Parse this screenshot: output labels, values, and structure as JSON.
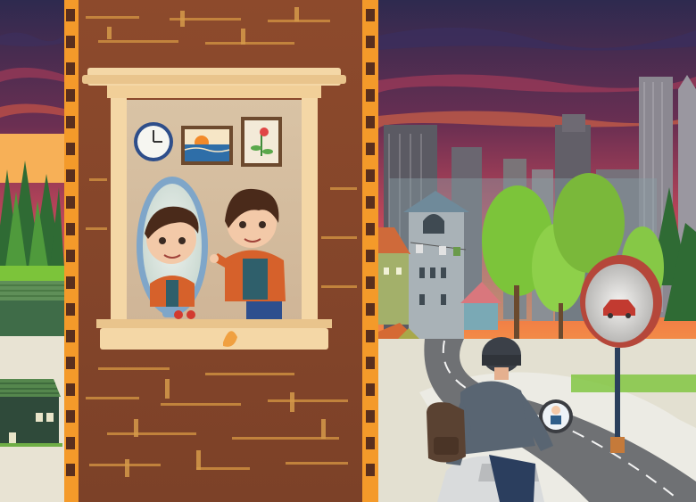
{
  "scene": {
    "left_panel": "countryside-sunset",
    "center_panel": "brick-wall-window-with-boy-at-mirror",
    "right_panel": "city-road-scooter-rider-convex-mirror"
  },
  "colors": {
    "sky_top": "#2e2a4f",
    "sky_mid": "#c4485a",
    "sky_glow": "#f6a04a",
    "brick_wall": "#8b4a2b",
    "film_border": "#f49a2a",
    "window_frame": "#f4d7a6",
    "road": "#6f7174",
    "tree_green": "#7cc43a",
    "pine_green": "#2f6b34"
  },
  "icons": [
    "clock-icon",
    "sunset-picture-icon",
    "flower-picture-icon",
    "hand-mirror-icon",
    "convex-traffic-mirror-icon",
    "scooter-icon",
    "helmet-icon",
    "backpack-icon",
    "red-car-reflection-icon"
  ]
}
